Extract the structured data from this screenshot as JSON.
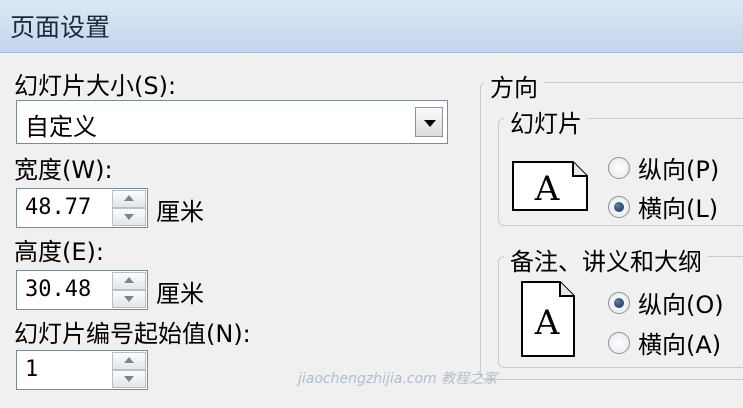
{
  "window": {
    "title": "页面设置"
  },
  "slide_size": {
    "label": "幻灯片大小(S):",
    "value": "自定义"
  },
  "width": {
    "label": "宽度(W):",
    "value": "48.77",
    "unit": "厘米"
  },
  "height": {
    "label": "高度(E):",
    "value": "30.48",
    "unit": "厘米"
  },
  "numbering": {
    "label": "幻灯片编号起始值(N):",
    "value": "1"
  },
  "orientation": {
    "title": "方向",
    "slides": {
      "title": "幻灯片",
      "portrait": "纵向(P)",
      "landscape": "横向(L)",
      "selected": "landscape"
    },
    "notes": {
      "title": "备注、讲义和大纲",
      "portrait": "纵向(O)",
      "landscape": "横向(A)",
      "selected": "portrait"
    }
  },
  "icons": {
    "slides_orientation": "page-letter-a-icon",
    "notes_orientation": "page-letter-a-icon",
    "page_glyph": "A"
  },
  "watermark": "jiaochengzhijia.com 教程之家",
  "colors": {
    "title_bar": "#c9daef",
    "dialog_bg": "#f0f0f0",
    "radio_dot": "#1e3c6e"
  }
}
